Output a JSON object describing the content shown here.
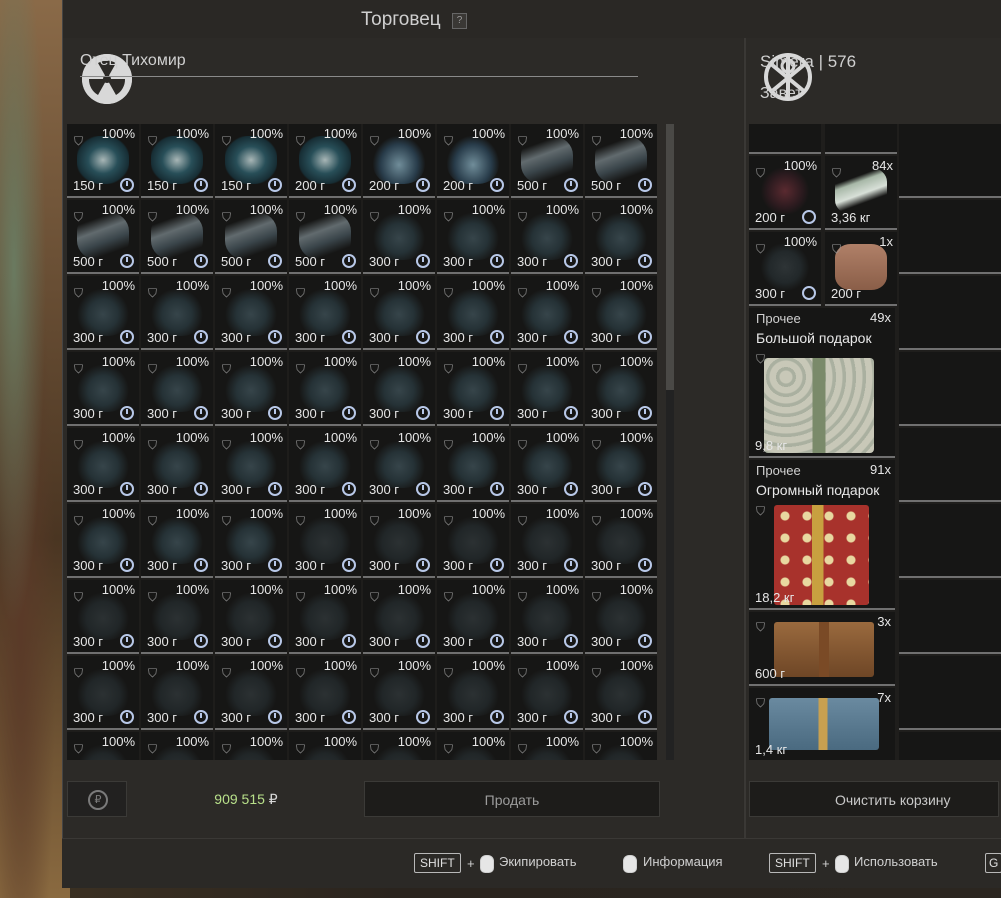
{
  "header": {
    "title": "Торговец",
    "help": "?"
  },
  "trader": {
    "name": "Отец Тихомир",
    "icon": "radiation-icon"
  },
  "player": {
    "name_level": "Simera | 576",
    "faction": "Завет",
    "icon": "faction-emblem-icon"
  },
  "trader_sidebar": [
    {
      "icon": "sort-icon",
      "glyph": "⇅",
      "active": false
    },
    {
      "icon": "star-icon",
      "glyph": "✶",
      "active": false
    },
    {
      "icon": "grid-icon",
      "glyph": "▦",
      "active": true
    },
    {
      "icon": "artifact-icon",
      "glyph": "✺",
      "active": false
    }
  ],
  "player_sidebar": [
    {
      "icon": "sort-icon",
      "glyph": "⇅",
      "active": false
    },
    {
      "icon": "star-icon",
      "glyph": "✶",
      "active": false
    },
    {
      "icon": "grid-icon",
      "glyph": "▦",
      "active": true
    },
    {
      "icon": "knife-icon",
      "glyph": "⟋",
      "active": false
    },
    {
      "icon": "artifact-icon",
      "glyph": "✺",
      "active": false
    },
    {
      "icon": "medkit-icon",
      "glyph": "⊕",
      "active": false
    },
    {
      "icon": "box-icon",
      "glyph": "▭",
      "active": false
    }
  ],
  "trader_inventory": {
    "condition": "100%",
    "rows": [
      [
        "150 г",
        "150 г",
        "150 г",
        "200 г",
        "200 г",
        "200 г",
        "500 г",
        "500 г"
      ],
      [
        "500 г",
        "500 г",
        "500 г",
        "500 г",
        "300 г",
        "300 г",
        "300 г",
        "300 г"
      ],
      [
        "300 г",
        "300 г",
        "300 г",
        "300 г",
        "300 г",
        "300 г",
        "300 г",
        "300 г"
      ],
      [
        "300 г",
        "300 г",
        "300 г",
        "300 г",
        "300 г",
        "300 г",
        "300 г",
        "300 г"
      ],
      [
        "300 г",
        "300 г",
        "300 г",
        "300 г",
        "300 г",
        "300 г",
        "300 г",
        "300 г"
      ],
      [
        "300 г",
        "300 г",
        "300 г",
        "300 г",
        "300 г",
        "300 г",
        "300 г",
        "300 г"
      ],
      [
        "300 г",
        "300 г",
        "300 г",
        "300 г",
        "300 г",
        "300 г",
        "300 г",
        "300 г"
      ],
      [
        "300 г",
        "300 г",
        "300 г",
        "300 г",
        "300 г",
        "300 г",
        "300 г",
        "300 г"
      ],
      [
        "",
        "",
        "",
        "",
        "",
        "",
        "",
        ""
      ]
    ],
    "kinds": [
      [
        "bone",
        "bone",
        "bone",
        "bone",
        "horn",
        "horn",
        "log",
        "log"
      ],
      [
        "log",
        "log",
        "log",
        "log",
        "plant",
        "plant",
        "plant",
        "plant"
      ],
      [
        "plant",
        "plant",
        "plant",
        "plant",
        "plant",
        "plant",
        "plant",
        "plant"
      ],
      [
        "plant",
        "plant",
        "plant",
        "plant",
        "plant",
        "plant",
        "plant",
        "plant"
      ],
      [
        "plant",
        "plant",
        "plant",
        "plant",
        "plant",
        "plant",
        "plant",
        "plant"
      ],
      [
        "plant",
        "plant",
        "plant",
        "rock",
        "rock",
        "rock",
        "rock",
        "rock"
      ],
      [
        "rock",
        "rock",
        "rock",
        "rock",
        "rock",
        "rock",
        "rock",
        "rock"
      ],
      [
        "rock",
        "rock",
        "rock",
        "rock",
        "rock",
        "rock",
        "rock",
        "rock"
      ],
      [
        "rock",
        "rock",
        "rock",
        "rock",
        "rock",
        "rock",
        "rock",
        "rock"
      ]
    ]
  },
  "player_inventory": {
    "small_items": [
      {
        "cond": "100%",
        "weight": "200 г",
        "timer": true
      },
      {
        "cond": "84x",
        "weight": "3,36 кг",
        "timer": false
      },
      {
        "cond": "100%",
        "weight": "300 г",
        "timer": true
      },
      {
        "cond": "1x",
        "weight": "200 г",
        "timer": false
      }
    ],
    "big_items": [
      {
        "category": "Прочее",
        "name": "Большой подарок",
        "count": "49x",
        "weight": "9,8 кг"
      },
      {
        "category": "Прочее",
        "name": "Огромный подарок",
        "count": "91x",
        "weight": "18,2 кг"
      },
      {
        "category": "",
        "name": "",
        "count": "3x",
        "weight": "600 г"
      },
      {
        "category": "",
        "name": "",
        "count": "7x",
        "weight": "1,4 кг"
      }
    ]
  },
  "footer": {
    "currency_icon": "ruble-cycle-icon",
    "money": "909 515",
    "currency": "₽",
    "sell_label": "Продать",
    "clear_label": "Очистить корзину"
  },
  "hints": {
    "shift": "SHIFT",
    "plus": "+",
    "equip": "Экипировать",
    "info": "Информация",
    "use": "Использовать",
    "g_key": "G"
  }
}
